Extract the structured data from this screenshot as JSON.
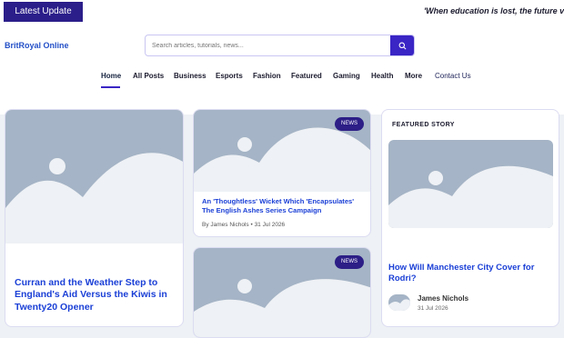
{
  "topbar": {
    "latest_label": "Latest Update",
    "ticker_text": "'When education is lost, the future vanishes'"
  },
  "header": {
    "brand": "BritRoyal Online",
    "search_placeholder": "Search articles, tutorials, news..."
  },
  "nav": {
    "items": [
      "Home",
      "All Posts",
      "Business",
      "Esports",
      "Fashion",
      "Featured",
      "Gaming",
      "Health",
      "More",
      "Contact Us"
    ]
  },
  "articles": [
    {
      "title": "Curran and the Weather Step to England's Aid Versus the Kiwis in Twenty20 Opener"
    },
    {
      "badge": "NEWS",
      "title": "An 'Thoughtless' Wicket Which 'Encapsulates' The English Ashes Series Campaign",
      "author": "By James Nichols",
      "date": "31 Jul 2026"
    },
    {
      "badge": "NEWS"
    }
  ],
  "featured": {
    "label": "FEATURED STORY",
    "title": "How Will Manchester City Cover for Rodri?",
    "author": "James Nichols",
    "date": "31 Jul 2026"
  },
  "colors": {
    "accent": "#3a25c5",
    "badge": "#2c1e86",
    "link": "#1a3fd6",
    "placeholder": "#a5b4c6"
  }
}
